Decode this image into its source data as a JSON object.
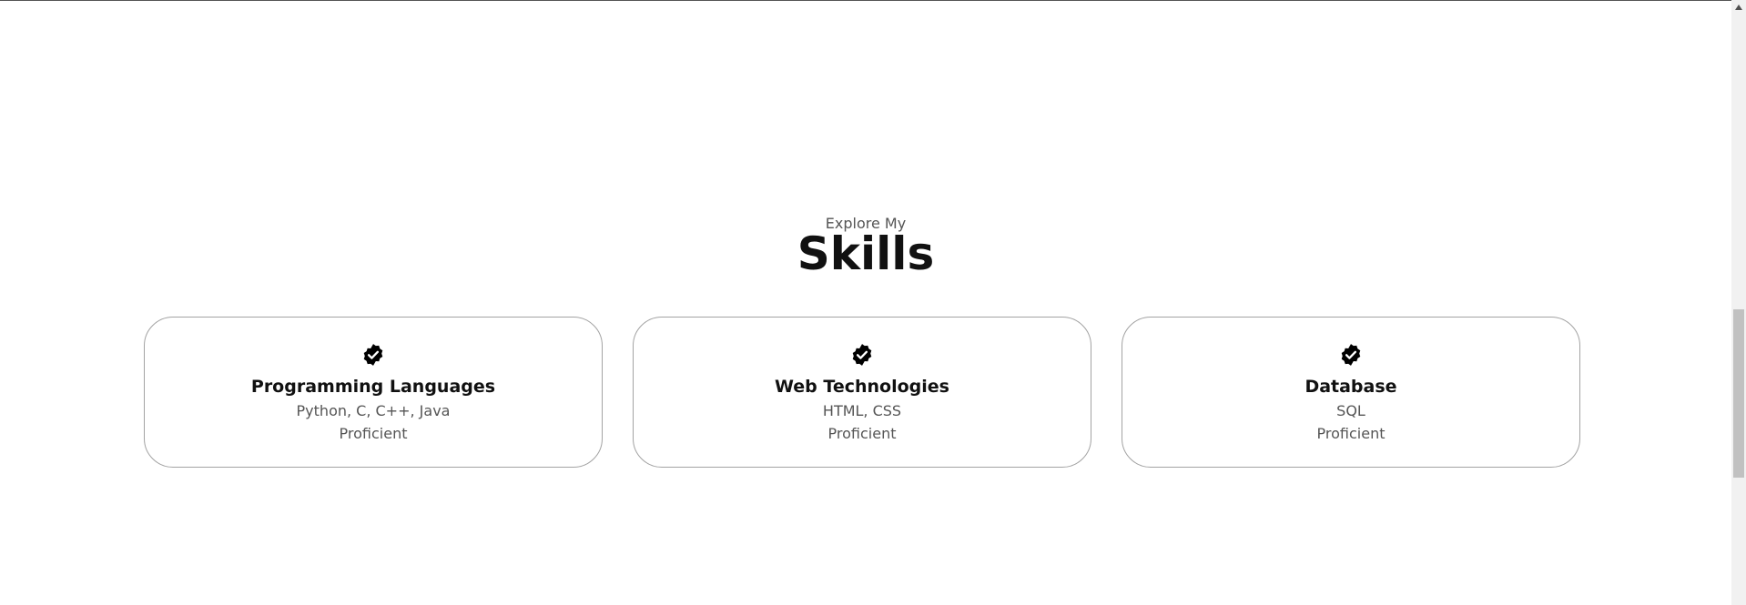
{
  "skills_section": {
    "subtitle": "Explore My",
    "title": "Skills",
    "cards": [
      {
        "icon": "verified-check-icon",
        "title": "Programming Languages",
        "detail": "Python, C, C++, Java",
        "level": "Proficient"
      },
      {
        "icon": "verified-check-icon",
        "title": "Web Technologies",
        "detail": "HTML, CSS",
        "level": "Proficient"
      },
      {
        "icon": "verified-check-icon",
        "title": "Database",
        "detail": "SQL",
        "level": "Proficient"
      }
    ]
  },
  "colors": {
    "text_primary": "#111111",
    "text_secondary": "#555555",
    "card_border": "#a3a3a3",
    "scrollbar_track": "#f1f1f1",
    "scrollbar_thumb": "#c1c1c1"
  },
  "scrollbar": {
    "position_fraction": 0.52
  }
}
